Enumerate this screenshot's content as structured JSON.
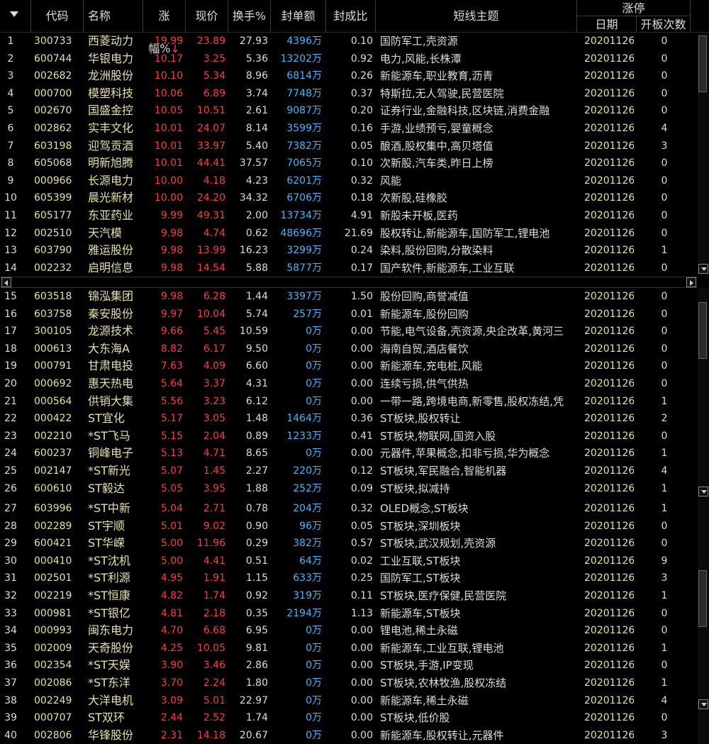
{
  "header": {
    "code": "代码",
    "name": "名称",
    "pct": "涨幅%",
    "sort_mark": "↓",
    "price": "现价",
    "turnover": "换手%",
    "seal_amount": "封单额",
    "seal_ratio": "封成比",
    "theme": "短线主题",
    "limit_group": "涨停",
    "date": "日期",
    "open_count": "开板次数"
  },
  "colors": {
    "up": "#ff3b3b",
    "code": "#e8e0a0",
    "amount": "#3fb8ff",
    "sort": "#ff3b3b"
  },
  "rows": [
    {
      "i": "1",
      "code": "300733",
      "name": "西菱动力",
      "pct": "19.99",
      "price": "23.89",
      "turn": "27.93",
      "amt": "4396万",
      "ratio": "0.10",
      "theme": "国防军工,壳资源",
      "date": "20201126",
      "cnt": "0"
    },
    {
      "i": "2",
      "code": "600744",
      "name": "华银电力",
      "pct": "10.17",
      "price": "3.25",
      "turn": "5.36",
      "amt": "13202万",
      "ratio": "0.92",
      "theme": "电力,风能,长株潭",
      "date": "20201126",
      "cnt": "0"
    },
    {
      "i": "3",
      "code": "002682",
      "name": "龙洲股份",
      "pct": "10.10",
      "price": "5.34",
      "turn": "8.96",
      "amt": "6814万",
      "ratio": "0.26",
      "theme": "新能源车,职业教育,沥青",
      "date": "20201126",
      "cnt": "0"
    },
    {
      "i": "4",
      "code": "000700",
      "name": "模塑科技",
      "pct": "10.06",
      "price": "6.89",
      "turn": "3.74",
      "amt": "7748万",
      "ratio": "0.37",
      "theme": "特斯拉,无人驾驶,民营医院",
      "date": "20201126",
      "cnt": "0"
    },
    {
      "i": "5",
      "code": "002670",
      "name": "国盛金控",
      "pct": "10.05",
      "price": "10.51",
      "turn": "2.61",
      "amt": "9087万",
      "ratio": "0.20",
      "theme": "证券行业,金融科技,区块链,消费金融",
      "date": "20201126",
      "cnt": "0"
    },
    {
      "i": "6",
      "code": "002862",
      "name": "实丰文化",
      "pct": "10.01",
      "price": "24.07",
      "turn": "8.14",
      "amt": "3599万",
      "ratio": "0.16",
      "theme": "手游,业绩预亏,婴童概念",
      "date": "20201126",
      "cnt": "4"
    },
    {
      "i": "7",
      "code": "603198",
      "name": "迎驾贡酒",
      "pct": "10.01",
      "price": "33.97",
      "turn": "5.40",
      "amt": "7382万",
      "ratio": "0.05",
      "theme": "酿酒,股权集中,高贝塔值",
      "date": "20201126",
      "cnt": "3"
    },
    {
      "i": "8",
      "code": "605068",
      "name": "明新旭腾",
      "pct": "10.01",
      "price": "44.41",
      "turn": "37.57",
      "amt": "7065万",
      "ratio": "0.10",
      "theme": "次新股,汽车类,昨日上榜",
      "date": "20201126",
      "cnt": "0"
    },
    {
      "i": "9",
      "code": "000966",
      "name": "长源电力",
      "pct": "10.00",
      "price": "4.18",
      "turn": "4.23",
      "amt": "6201万",
      "ratio": "0.32",
      "theme": "风能",
      "date": "20201126",
      "cnt": "0"
    },
    {
      "i": "10",
      "code": "605399",
      "name": "晨光新材",
      "pct": "10.00",
      "price": "24.20",
      "turn": "34.32",
      "amt": "6706万",
      "ratio": "0.18",
      "theme": "次新股,硅橡胶",
      "date": "20201126",
      "cnt": "0"
    },
    {
      "i": "11",
      "code": "605177",
      "name": "东亚药业",
      "pct": "9.99",
      "price": "49.31",
      "turn": "2.00",
      "amt": "13734万",
      "ratio": "4.91",
      "theme": "新股未开板,医药",
      "date": "20201126",
      "cnt": "0"
    },
    {
      "i": "12",
      "code": "002510",
      "name": "天汽模",
      "pct": "9.98",
      "price": "4.74",
      "turn": "0.62",
      "amt": "48696万",
      "ratio": "21.69",
      "theme": "股权转让,新能源车,国防军工,锂电池",
      "date": "20201126",
      "cnt": "0"
    },
    {
      "i": "13",
      "code": "603790",
      "name": "雅运股份",
      "pct": "9.98",
      "price": "13.99",
      "turn": "16.23",
      "amt": "3299万",
      "ratio": "0.24",
      "theme": "染料,股份回购,分散染料",
      "date": "20201126",
      "cnt": "1"
    },
    {
      "i": "14",
      "code": "002232",
      "name": "启明信息",
      "pct": "9.98",
      "price": "14.54",
      "turn": "5.88",
      "amt": "5877万",
      "ratio": "0.17",
      "theme": "国产软件,新能源车,工业互联",
      "date": "20201126",
      "cnt": "0"
    },
    {
      "i": "15",
      "code": "603518",
      "name": "锦泓集团",
      "pct": "9.98",
      "price": "6.28",
      "turn": "1.44",
      "amt": "3397万",
      "ratio": "1.50",
      "theme": "股份回购,商誉减值",
      "date": "20201126",
      "cnt": "0"
    },
    {
      "i": "16",
      "code": "603758",
      "name": "秦安股份",
      "pct": "9.97",
      "price": "10.04",
      "turn": "5.74",
      "amt": "257万",
      "ratio": "0.01",
      "theme": "新能源车,股份回购",
      "date": "20201126",
      "cnt": "0"
    },
    {
      "i": "17",
      "code": "300105",
      "name": "龙源技术",
      "pct": "9.66",
      "price": "5.45",
      "turn": "10.59",
      "amt": "0万",
      "ratio": "0.00",
      "theme": "节能,电气设备,壳资源,央企改革,黄河三",
      "date": "20201126",
      "cnt": "0"
    },
    {
      "i": "18",
      "code": "000613",
      "name": "大东海A",
      "pct": "8.82",
      "price": "6.17",
      "turn": "9.50",
      "amt": "0万",
      "ratio": "0.00",
      "theme": "海南自贸,酒店餐饮",
      "date": "20201126",
      "cnt": "0"
    },
    {
      "i": "19",
      "code": "000791",
      "name": "甘肃电投",
      "pct": "7.63",
      "price": "4.09",
      "turn": "6.60",
      "amt": "0万",
      "ratio": "0.00",
      "theme": "新能源车,充电桩,风能",
      "date": "20201126",
      "cnt": "0"
    },
    {
      "i": "20",
      "code": "000692",
      "name": "惠天热电",
      "pct": "5.64",
      "price": "3.37",
      "turn": "4.31",
      "amt": "0万",
      "ratio": "0.00",
      "theme": "连续亏损,供气供热",
      "date": "20201126",
      "cnt": "0"
    },
    {
      "i": "21",
      "code": "000564",
      "name": "供销大集",
      "pct": "5.56",
      "price": "3.23",
      "turn": "6.12",
      "amt": "0万",
      "ratio": "0.00",
      "theme": "一带一路,跨境电商,新零售,股权冻结,凭",
      "date": "20201126",
      "cnt": "1"
    },
    {
      "i": "22",
      "code": "000422",
      "name": "ST宜化",
      "pct": "5.17",
      "price": "3.05",
      "turn": "1.48",
      "amt": "1464万",
      "ratio": "0.36",
      "theme": "ST板块,股权转让",
      "date": "20201126",
      "cnt": "2"
    },
    {
      "i": "23",
      "code": "002210",
      "name": "*ST飞马",
      "pct": "5.15",
      "price": "2.04",
      "turn": "0.89",
      "amt": "1233万",
      "ratio": "0.41",
      "theme": "ST板块,物联网,国资入股",
      "date": "20201126",
      "cnt": "0"
    },
    {
      "i": "24",
      "code": "600237",
      "name": "铜峰电子",
      "pct": "5.13",
      "price": "4.71",
      "turn": "8.65",
      "amt": "0万",
      "ratio": "0.00",
      "theme": "元器件,苹果概念,扣非亏损,华为概念",
      "date": "20201126",
      "cnt": "1"
    },
    {
      "i": "25",
      "code": "002147",
      "name": "*ST新光",
      "pct": "5.07",
      "price": "1.45",
      "turn": "2.27",
      "amt": "220万",
      "ratio": "0.12",
      "theme": "ST板块,军民融合,智能机器",
      "date": "20201126",
      "cnt": "4"
    },
    {
      "i": "26",
      "code": "600610",
      "name": "ST毅达",
      "pct": "5.05",
      "price": "3.95",
      "turn": "1.88",
      "amt": "252万",
      "ratio": "0.09",
      "theme": "ST板块,拟减持",
      "date": "20201126",
      "cnt": "1"
    },
    {
      "i": "27",
      "code": "603996",
      "name": "*ST中新",
      "pct": "5.04",
      "price": "2.71",
      "turn": "0.78",
      "amt": "204万",
      "ratio": "0.32",
      "theme": "OLED概念,ST板块",
      "date": "20201126",
      "cnt": "1"
    },
    {
      "i": "28",
      "code": "002289",
      "name": "ST宇顺",
      "pct": "5.01",
      "price": "9.02",
      "turn": "0.90",
      "amt": "96万",
      "ratio": "0.05",
      "theme": "ST板块,深圳板块",
      "date": "20201126",
      "cnt": "0"
    },
    {
      "i": "29",
      "code": "600421",
      "name": "ST华嵘",
      "pct": "5.00",
      "price": "11.96",
      "turn": "0.29",
      "amt": "382万",
      "ratio": "0.57",
      "theme": "ST板块,武汉规划,壳资源",
      "date": "20201126",
      "cnt": "0"
    },
    {
      "i": "30",
      "code": "000410",
      "name": "*ST沈机",
      "pct": "5.00",
      "price": "4.41",
      "turn": "0.51",
      "amt": "64万",
      "ratio": "0.02",
      "theme": "工业互联,ST板块",
      "date": "20201126",
      "cnt": "9"
    },
    {
      "i": "31",
      "code": "002501",
      "name": "*ST利源",
      "pct": "4.95",
      "price": "1.91",
      "turn": "1.15",
      "amt": "633万",
      "ratio": "0.25",
      "theme": "国防军工,ST板块",
      "date": "20201126",
      "cnt": "3"
    },
    {
      "i": "32",
      "code": "002219",
      "name": "*ST恒康",
      "pct": "4.82",
      "price": "1.74",
      "turn": "0.92",
      "amt": "319万",
      "ratio": "0.11",
      "theme": "ST板块,医疗保健,民营医院",
      "date": "20201126",
      "cnt": "1"
    },
    {
      "i": "33",
      "code": "000981",
      "name": "*ST银亿",
      "pct": "4.81",
      "price": "2.18",
      "turn": "0.35",
      "amt": "2194万",
      "ratio": "1.13",
      "theme": "新能源车,ST板块",
      "date": "20201126",
      "cnt": "0"
    },
    {
      "i": "34",
      "code": "000993",
      "name": "闽东电力",
      "pct": "4.70",
      "price": "6.68",
      "turn": "6.95",
      "amt": "0万",
      "ratio": "0.00",
      "theme": "锂电池,稀土永磁",
      "date": "20201126",
      "cnt": "0"
    },
    {
      "i": "35",
      "code": "002009",
      "name": "天奇股份",
      "pct": "4.25",
      "price": "10.05",
      "turn": "9.81",
      "amt": "0万",
      "ratio": "0.00",
      "theme": "新能源车,工业互联,锂电池",
      "date": "20201126",
      "cnt": "1"
    },
    {
      "i": "36",
      "code": "002354",
      "name": "*ST天娱",
      "pct": "3.90",
      "price": "3.46",
      "turn": "2.86",
      "amt": "0万",
      "ratio": "0.00",
      "theme": "ST板块,手游,IP变现",
      "date": "20201126",
      "cnt": "0"
    },
    {
      "i": "37",
      "code": "002086",
      "name": "*ST东洋",
      "pct": "3.70",
      "price": "2.24",
      "turn": "1.80",
      "amt": "0万",
      "ratio": "0.00",
      "theme": "ST板块,农林牧渔,股权冻结",
      "date": "20201126",
      "cnt": "1"
    },
    {
      "i": "38",
      "code": "002249",
      "name": "大洋电机",
      "pct": "3.09",
      "price": "5.01",
      "turn": "22.97",
      "amt": "0万",
      "ratio": "0.00",
      "theme": "新能源车,稀土永磁",
      "date": "20201126",
      "cnt": "4"
    },
    {
      "i": "39",
      "code": "000707",
      "name": "ST双环",
      "pct": "2.44",
      "price": "2.52",
      "turn": "1.74",
      "amt": "0万",
      "ratio": "0.00",
      "theme": "ST板块,低价股",
      "date": "20201126",
      "cnt": "0"
    },
    {
      "i": "40",
      "code": "002806",
      "name": "华锋股份",
      "pct": "2.31",
      "price": "14.18",
      "turn": "20.67",
      "amt": "0万",
      "ratio": "0.00",
      "theme": "新能源车,股权转让,元器件",
      "date": "20201126",
      "cnt": "3"
    }
  ]
}
